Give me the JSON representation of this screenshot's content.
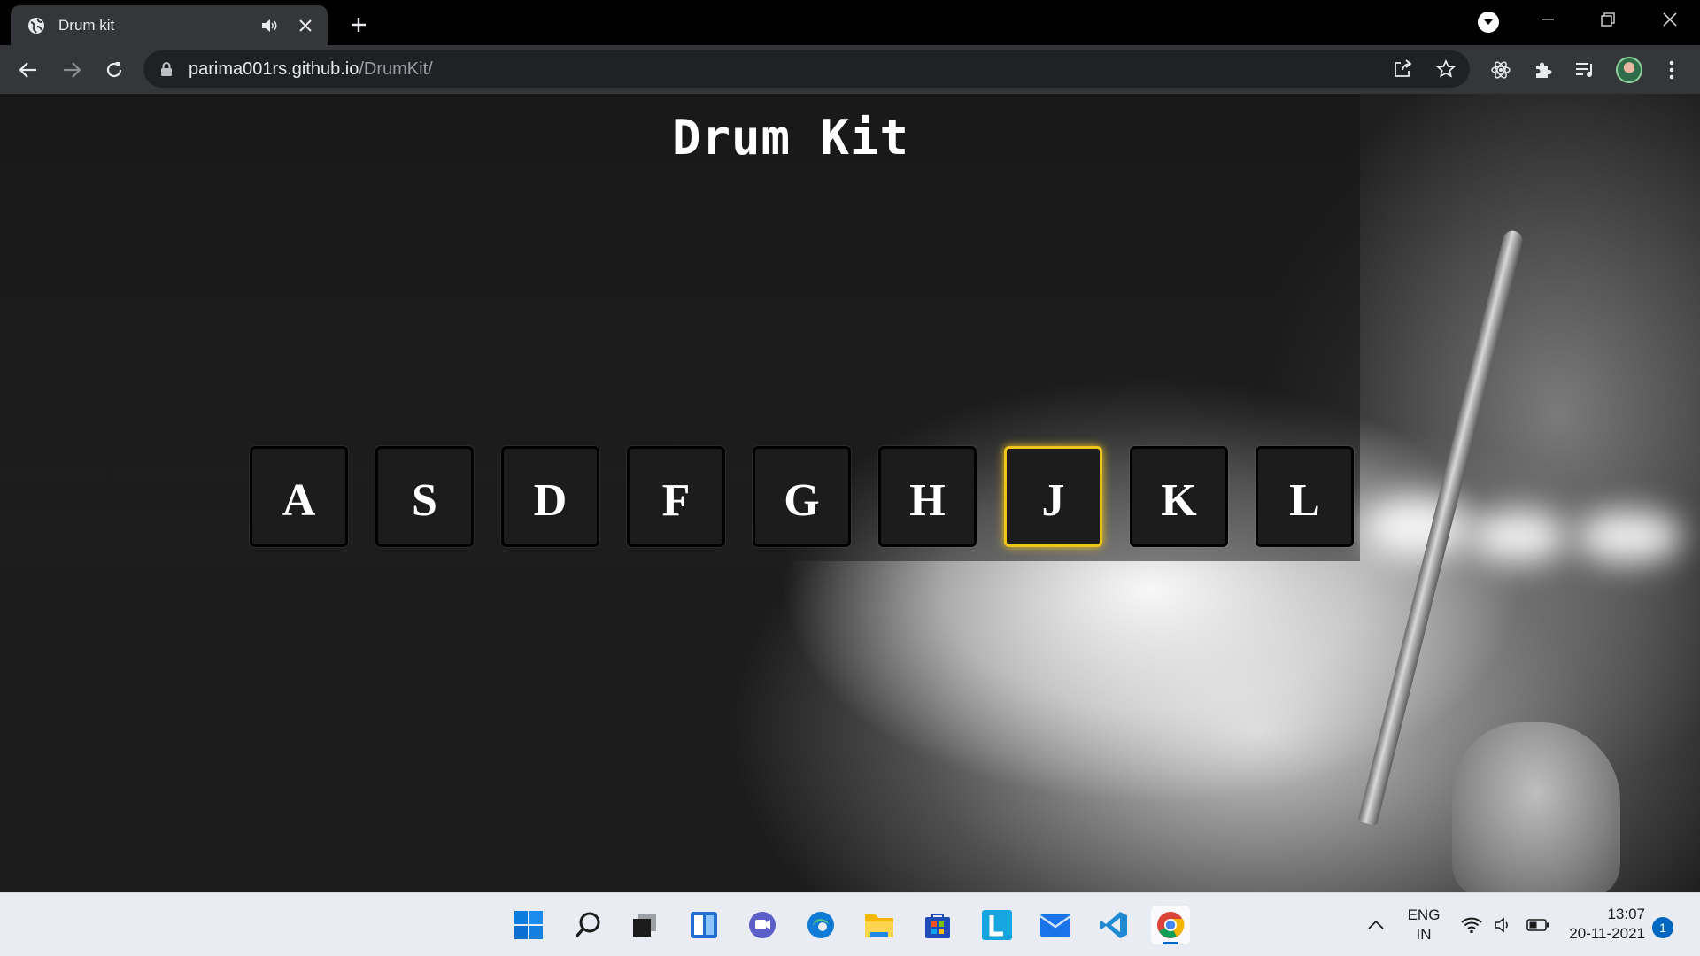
{
  "browser": {
    "tab": {
      "title": "Drum kit"
    },
    "address": {
      "host": "parima001rs.github.io",
      "path": "/DrumKit/"
    }
  },
  "page": {
    "title": "Drum Kit",
    "keys": [
      {
        "label": "A",
        "active": false
      },
      {
        "label": "S",
        "active": false
      },
      {
        "label": "D",
        "active": false
      },
      {
        "label": "F",
        "active": false
      },
      {
        "label": "G",
        "active": false
      },
      {
        "label": "H",
        "active": false
      },
      {
        "label": "J",
        "active": true
      },
      {
        "label": "K",
        "active": false
      },
      {
        "label": "L",
        "active": false
      }
    ],
    "active_border_color": "#f0c419"
  },
  "taskbar": {
    "apps": [
      "start-icon",
      "search-icon",
      "task-view-icon",
      "widgets-icon",
      "teams-chat-icon",
      "edge-icon",
      "file-explorer-icon",
      "microsoft-store-icon",
      "l-app-icon",
      "mail-icon",
      "vscode-icon",
      "chrome-icon"
    ],
    "language_line1": "ENG",
    "language_line2": "IN",
    "time": "13:07",
    "date": "20-11-2021",
    "notification_count": "1"
  }
}
